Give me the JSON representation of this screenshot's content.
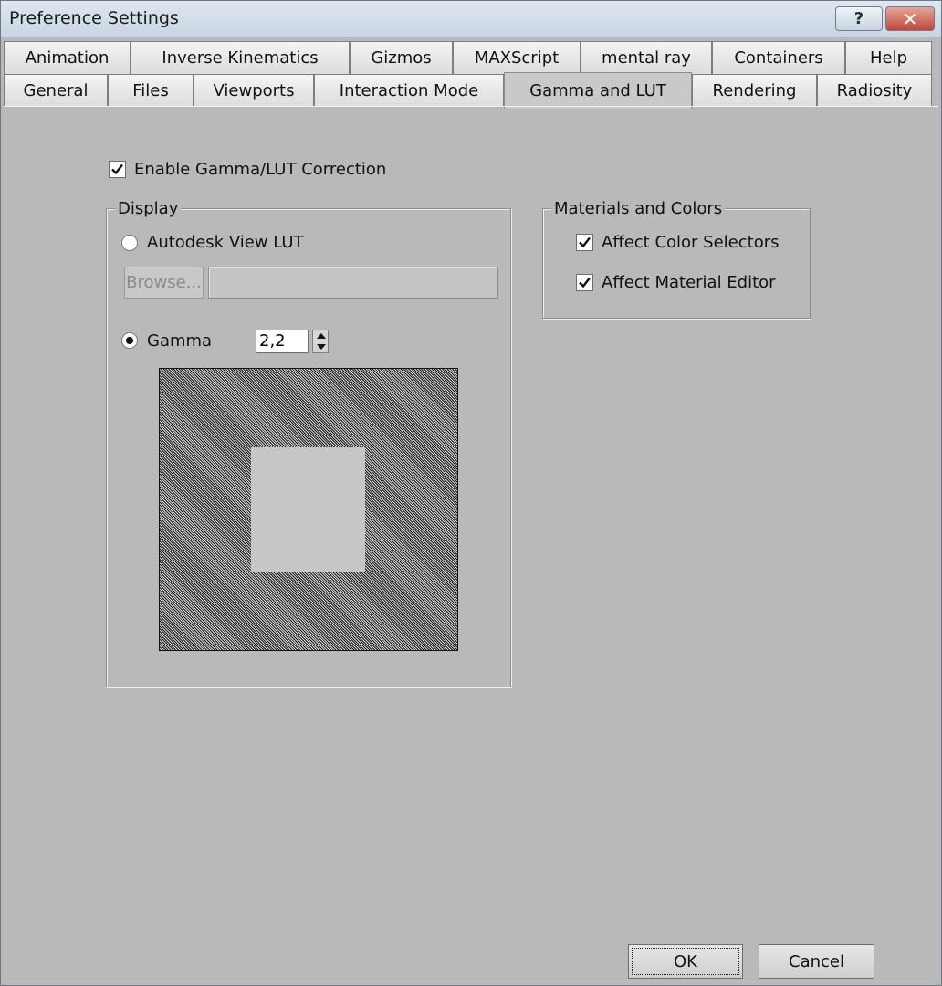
{
  "window": {
    "title": "Preference Settings",
    "help_button": "?",
    "close_button": "✕"
  },
  "tabs": {
    "row1": [
      "Animation",
      "Inverse Kinematics",
      "Gizmos",
      "MAXScript",
      "mental ray",
      "Containers",
      "Help"
    ],
    "row2": [
      "General",
      "Files",
      "Viewports",
      "Interaction Mode",
      "Gamma and LUT",
      "Rendering",
      "Radiosity"
    ],
    "active": "Gamma and LUT"
  },
  "enable_correction": {
    "label": "Enable Gamma/LUT Correction",
    "checked": true
  },
  "display": {
    "legend": "Display",
    "lut_option": {
      "label": "Autodesk View LUT",
      "selected": false
    },
    "browse_label": "Browse...",
    "lut_path": "",
    "gamma_option": {
      "label": "Gamma",
      "selected": true
    },
    "gamma_value": "2,2"
  },
  "materials": {
    "legend": "Materials and Colors",
    "affect_color_selectors": {
      "label": "Affect Color Selectors",
      "checked": true
    },
    "affect_material_editor": {
      "label": "Affect Material Editor",
      "checked": true
    }
  },
  "footer": {
    "ok_label": "OK",
    "cancel_label": "Cancel"
  },
  "icons": {
    "help": "question-icon",
    "close": "close-icon",
    "check": "checkmark-icon",
    "spin_up": "arrow-up-icon",
    "spin_down": "arrow-down-icon"
  }
}
